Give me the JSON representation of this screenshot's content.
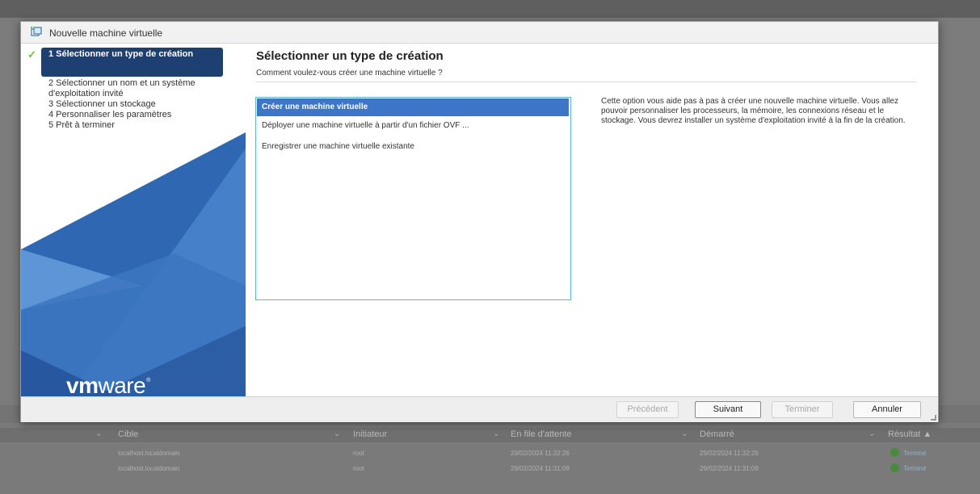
{
  "dialog": {
    "title": "Nouvelle machine virtuelle"
  },
  "sidebar": {
    "steps": [
      {
        "label": "1 Sélectionner un type de création",
        "active": true
      },
      {
        "label": "2 Sélectionner un nom et un système d'exploitation invité"
      },
      {
        "label": "3 Sélectionner un stockage"
      },
      {
        "label": "4 Personnaliser les paramètres"
      },
      {
        "label": "5 Prêt à terminer"
      }
    ],
    "logo_prefix": "vm",
    "logo_suffix": "ware",
    "logo_mark": "®"
  },
  "main": {
    "heading": "Sélectionner un type de création",
    "subheading": "Comment voulez-vous créer une machine virtuelle ?",
    "options": [
      {
        "label": "Créer une machine virtuelle",
        "selected": true
      },
      {
        "label": "Déployer une machine virtuelle à partir d'un fichier OVF ..."
      },
      {
        "label": "Enregistrer une machine virtuelle existante"
      }
    ],
    "description": "Cette option vous aide pas à pas à créer une nouvelle machine virtuelle. Vous allez pouvoir personnaliser les processeurs, la mémoire, les connexions réseau et le stockage. Vous devrez installer un système d'exploitation invité à la fin de la création."
  },
  "footer": {
    "back_label": "Précédent",
    "next_label": "Suivant",
    "finish_label": "Terminer",
    "cancel_label": "Annuler"
  },
  "background_table": {
    "columns": [
      "Cible",
      "Initiateur",
      "En file d'attente",
      "Démarré",
      "Résultat ▲"
    ],
    "rows": [
      {
        "target": "localhost.localdomain",
        "initiator": "root",
        "queued": "29/02/2024 11:32:26",
        "started": "29/02/2024 11:32:26",
        "result": "Terminé"
      },
      {
        "target": "localhost.localdomain",
        "initiator": "root",
        "queued": "29/02/2024 11:31:09",
        "started": "29/02/2024 11:31:09",
        "result": "Terminé"
      }
    ]
  },
  "colors": {
    "sidebar_blue": "#3e6dac",
    "active_step": "#1d3f71",
    "selected_option": "#3d76c8",
    "list_border": "#5db5e3",
    "check_green": "#6cbf3c"
  }
}
